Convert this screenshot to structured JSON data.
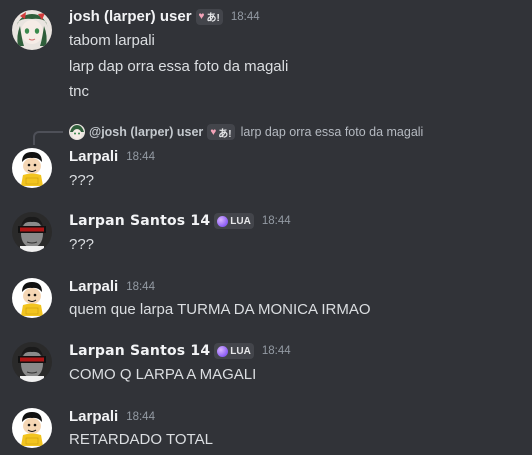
{
  "messages": [
    {
      "author": "josh (larper) user",
      "badge": "あ!",
      "time": "18:44",
      "lines": [
        "tabom larpali",
        "larp dap orra essa foto da magali",
        "tnc"
      ]
    },
    {
      "reply": {
        "author": "@josh (larper) user",
        "badge": "あ!",
        "text": "larp dap orra essa foto da magali"
      },
      "author": "Larpali",
      "time": "18:44",
      "lines": [
        "???"
      ]
    },
    {
      "author": "Larpan Santos 14",
      "badge": "LUA",
      "time": "18:44",
      "lines": [
        "???"
      ]
    },
    {
      "author": "Larpali",
      "time": "18:44",
      "lines": [
        "quem que larpa TURMA DA MONICA IRMAO"
      ]
    },
    {
      "author": "Larpan Santos 14",
      "badge": "LUA",
      "time": "18:44",
      "lines": [
        "COMO Q LARPA A MAGALI"
      ]
    },
    {
      "author": "Larpali",
      "time": "18:44",
      "lines": [
        "RETARDADO TOTAL"
      ]
    }
  ],
  "avatars": {
    "josh": "anime-avatar-icon",
    "larpali": "cartoon-boy-avatar-icon",
    "larpan": "censored-man-avatar-icon"
  },
  "colors": {
    "background": "#313338",
    "text": "#dbdee1",
    "timestamp": "#949ba4",
    "username": "#f2f3f5",
    "lua_badge": "#8b5cf6"
  }
}
